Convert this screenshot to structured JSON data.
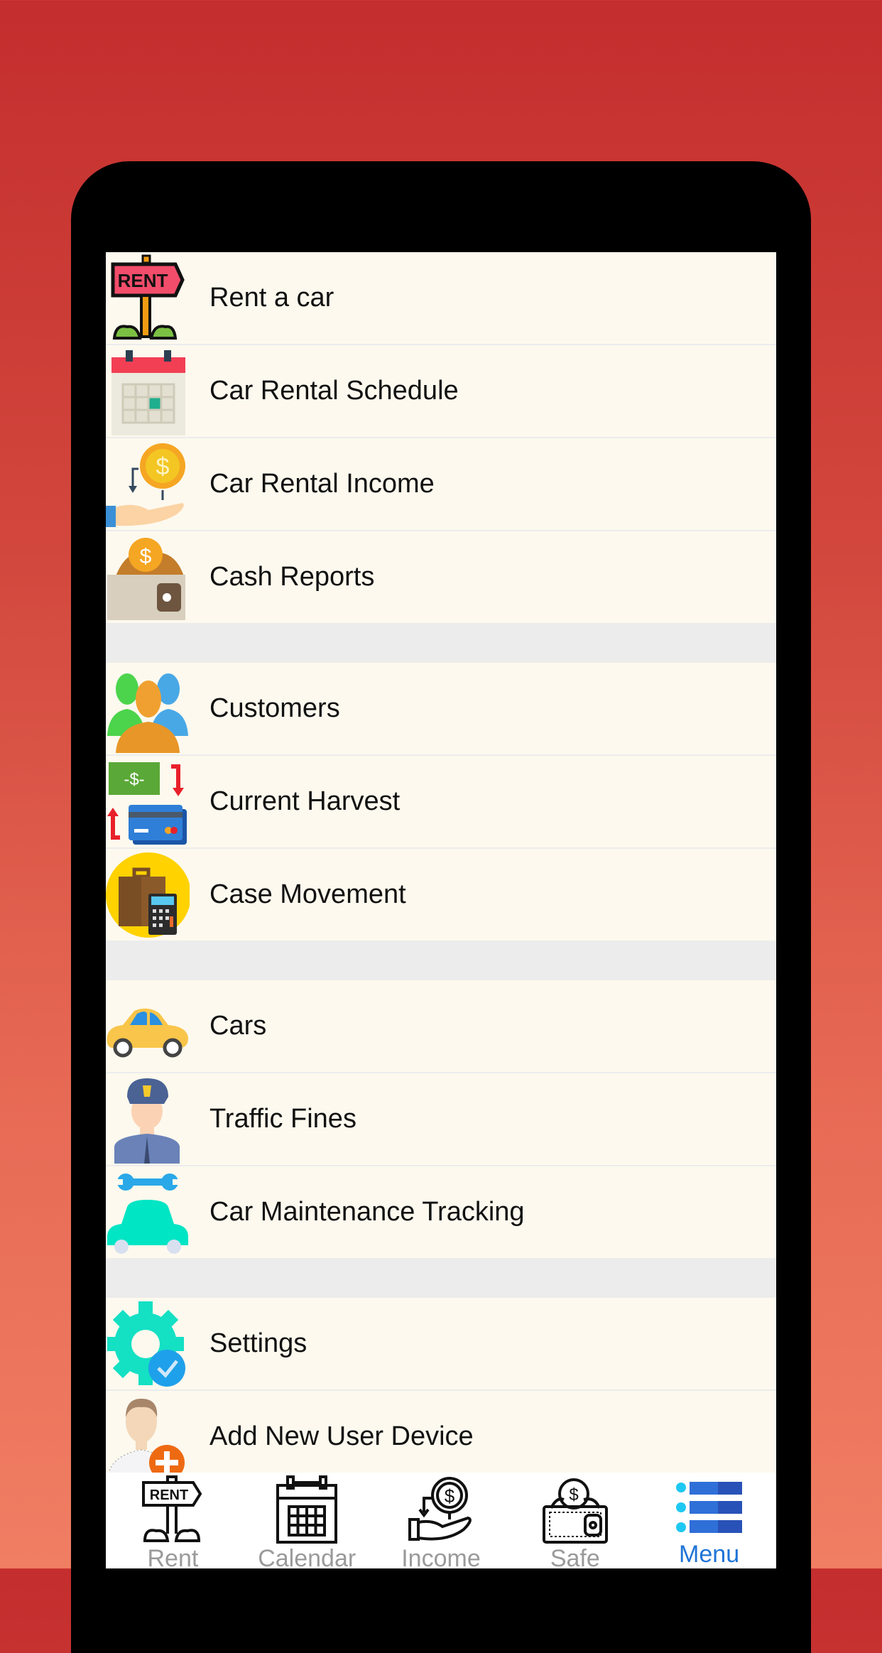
{
  "menu": {
    "groups": [
      {
        "items": [
          {
            "label": "Rent a car",
            "icon": "rent-sign-icon"
          },
          {
            "label": "Car Rental Schedule",
            "icon": "calendar-icon"
          },
          {
            "label": "Car Rental Income",
            "icon": "coin-hand-icon"
          },
          {
            "label": "Cash Reports",
            "icon": "wallet-icon"
          }
        ]
      },
      {
        "items": [
          {
            "label": "Customers",
            "icon": "users-icon"
          },
          {
            "label": "Current Harvest",
            "icon": "cash-card-exchange-icon"
          },
          {
            "label": "Case Movement",
            "icon": "briefcase-calculator-icon"
          }
        ]
      },
      {
        "items": [
          {
            "label": "Cars",
            "icon": "car-icon"
          },
          {
            "label": "Traffic Fines",
            "icon": "police-officer-icon"
          },
          {
            "label": "Car Maintenance Tracking",
            "icon": "wrench-car-icon"
          }
        ]
      },
      {
        "items": [
          {
            "label": "Settings",
            "icon": "gear-check-icon"
          },
          {
            "label": "Add New User Device",
            "icon": "add-user-icon"
          }
        ]
      }
    ]
  },
  "tabbar": {
    "active": "Menu",
    "active_color": "#1f74d6",
    "tabs": [
      {
        "label": "Rent",
        "icon": "rent-sign-icon"
      },
      {
        "label": "Calendar",
        "icon": "calendar-icon"
      },
      {
        "label": "Income",
        "icon": "coin-hand-icon"
      },
      {
        "label": "Safe",
        "icon": "wallet-icon"
      },
      {
        "label": "Menu",
        "icon": "list-menu-icon"
      }
    ]
  }
}
